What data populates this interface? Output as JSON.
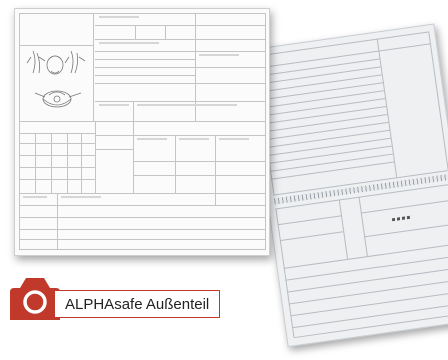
{
  "caption": {
    "label": "ALPHAsafe Außenteil"
  },
  "colors": {
    "accent": "#c0392b",
    "sheet_front": "#fbfbfb",
    "sheet_back": "#eef0f2"
  },
  "icons": {
    "badge": "camera-icon"
  }
}
